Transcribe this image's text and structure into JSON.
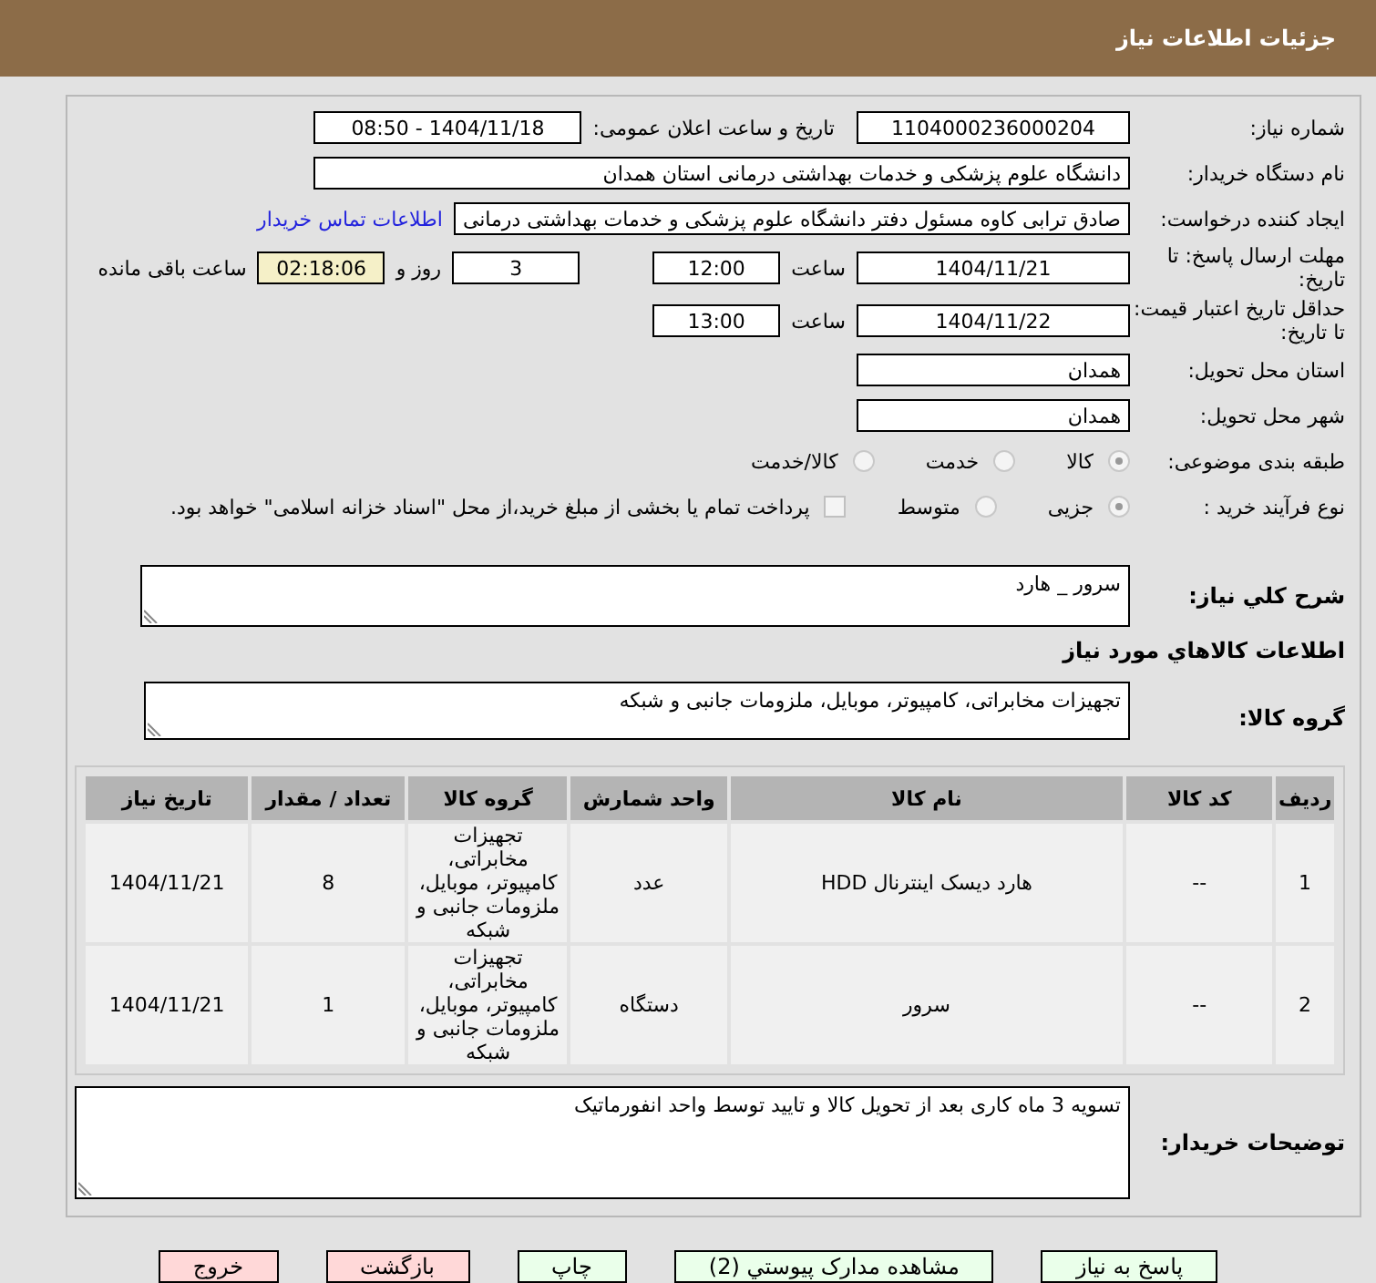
{
  "header": {
    "title": "جزئیات اطلاعات نیاز"
  },
  "need_number": {
    "label": "شماره نیاز:",
    "value": "1104000236000204"
  },
  "announce": {
    "label": "تاریخ و ساعت اعلان عمومی:",
    "value": "1404/11/18 - 08:50"
  },
  "buyer_org": {
    "label": "نام دستگاه خریدار:",
    "value": "دانشگاه علوم پزشکی و خدمات بهداشتی درمانی استان همدان"
  },
  "requester": {
    "label": "ایجاد کننده درخواست:",
    "value": "صادق ترابی کاوه مسئول دفتر دانشگاه علوم پزشکی و خدمات بهداشتی درمانی",
    "link": "اطلاعات تماس خریدار"
  },
  "reply_deadline": {
    "label": "مهلت ارسال پاسخ: تا تاریخ:",
    "date": "1404/11/21",
    "time_label": "ساعت",
    "time": "12:00",
    "days": "3",
    "days_label": "روز و",
    "remaining": "02:18:06",
    "remaining_label": "ساعت باقی مانده"
  },
  "price_validity": {
    "label": "حداقل تاریخ اعتبار قیمت: تا تاریخ:",
    "date": "1404/11/22",
    "time_label": "ساعت",
    "time": "13:00"
  },
  "province": {
    "label": "استان محل تحویل:",
    "value": "همدان"
  },
  "city": {
    "label": "شهر محل تحویل:",
    "value": "همدان"
  },
  "category": {
    "label": "طبقه بندی موضوعی:",
    "options": [
      {
        "label": "کالا",
        "selected": true
      },
      {
        "label": "خدمت",
        "selected": false
      },
      {
        "label": "کالا/خدمت",
        "selected": false
      }
    ]
  },
  "process": {
    "label": "نوع فرآیند خرید :",
    "options": [
      {
        "label": "جزیی",
        "selected": true
      },
      {
        "label": "متوسط",
        "selected": false
      }
    ],
    "payment": {
      "label": "پرداخت تمام یا بخشی از مبلغ خرید،از محل \"اسناد خزانه اسلامی\" خواهد بود.",
      "checked": false
    }
  },
  "description": {
    "label": "شرح کلي نياز:",
    "value": "سرور _ هارد"
  },
  "goods_heading": "اطلاعات کالاهاي مورد نياز",
  "goods_group": {
    "label": "گروه کالا:",
    "value": "تجهیزات مخابراتی، کامپیوتر، موبایل، ملزومات جانبی و شبکه"
  },
  "table": {
    "columns": [
      "ردیف",
      "کد کالا",
      "نام کالا",
      "واحد شمارش",
      "گروه کالا",
      "تعداد / مقدار",
      "تاریخ نیاز"
    ],
    "rows": [
      [
        "1",
        "--",
        "هارد دیسک اینترنال HDD",
        "عدد",
        "تجهیزات مخابراتی، کامپیوتر، موبایل، ملزومات جانبی و شبکه",
        "8",
        "1404/11/21"
      ],
      [
        "2",
        "--",
        "سرور",
        "دستگاه",
        "تجهیزات مخابراتی، کامپیوتر، موبایل، ملزومات جانبی و شبکه",
        "1",
        "1404/11/21"
      ]
    ]
  },
  "notes": {
    "label": "توضیحات خریدار:",
    "value": "تسویه 3 ماه کاری بعد از تحویل کالا و تایید توسط واحد انفورماتیک"
  },
  "buttons": [
    {
      "label": "پاسخ به نیاز",
      "kind": "primary"
    },
    {
      "label": "مشاهده مدارک پیوستي (2)",
      "kind": "primary"
    },
    {
      "label": "چاپ",
      "kind": "primary"
    },
    {
      "label": "بازگشت",
      "kind": "danger"
    },
    {
      "label": "خروج",
      "kind": "danger"
    }
  ]
}
